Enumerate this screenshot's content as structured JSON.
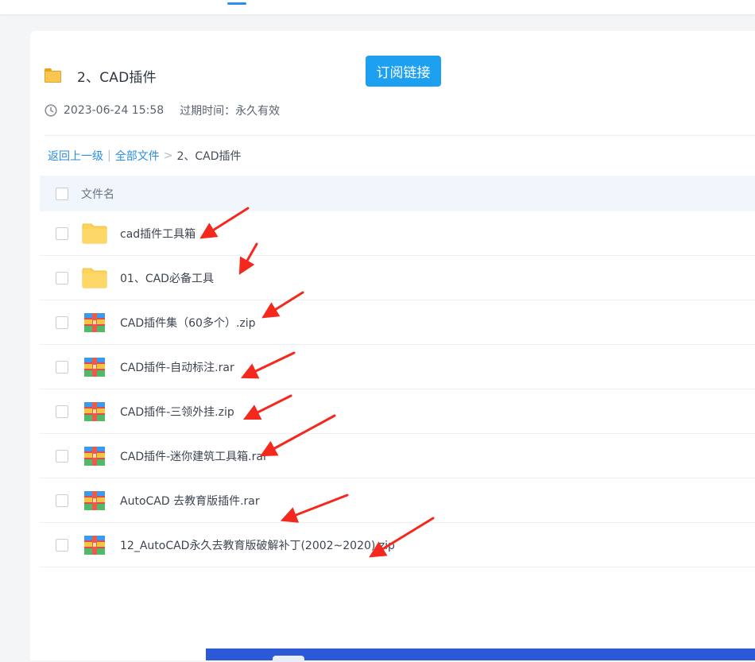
{
  "folder": {
    "title": "2、CAD插件",
    "subscribe_label": "订阅链接",
    "date": "2023-06-24 15:58",
    "expiry": "过期时间：永久有效"
  },
  "breadcrumb": {
    "back": "返回上一级",
    "separator": "|",
    "all_files": "全部文件",
    "chevron": ">",
    "current": "2、CAD插件"
  },
  "table": {
    "header_label": "文件名",
    "rows": [
      {
        "name": "cad插件工具箱",
        "icon": "folder-icon"
      },
      {
        "name": "01、CAD必备工具",
        "icon": "folder-icon"
      },
      {
        "name": "CAD插件集（60多个）.zip",
        "icon": "archive-icon"
      },
      {
        "name": "CAD插件-自动标注.rar",
        "icon": "archive-icon"
      },
      {
        "name": "CAD插件-三领外挂.zip",
        "icon": "archive-icon"
      },
      {
        "name": "CAD插件-迷你建筑工具箱.rar",
        "icon": "archive-icon"
      },
      {
        "name": "AutoCAD 去教育版插件.rar",
        "icon": "archive-icon"
      },
      {
        "name": "12_AutoCAD永久去教育版破解补丁(2002~2020).zip",
        "icon": "archive-icon"
      }
    ]
  },
  "colors": {
    "accent": "#1ea0f0",
    "link": "#2a8ee0",
    "annotation_arrow": "#f5281e",
    "folder": "#f9c74f"
  }
}
